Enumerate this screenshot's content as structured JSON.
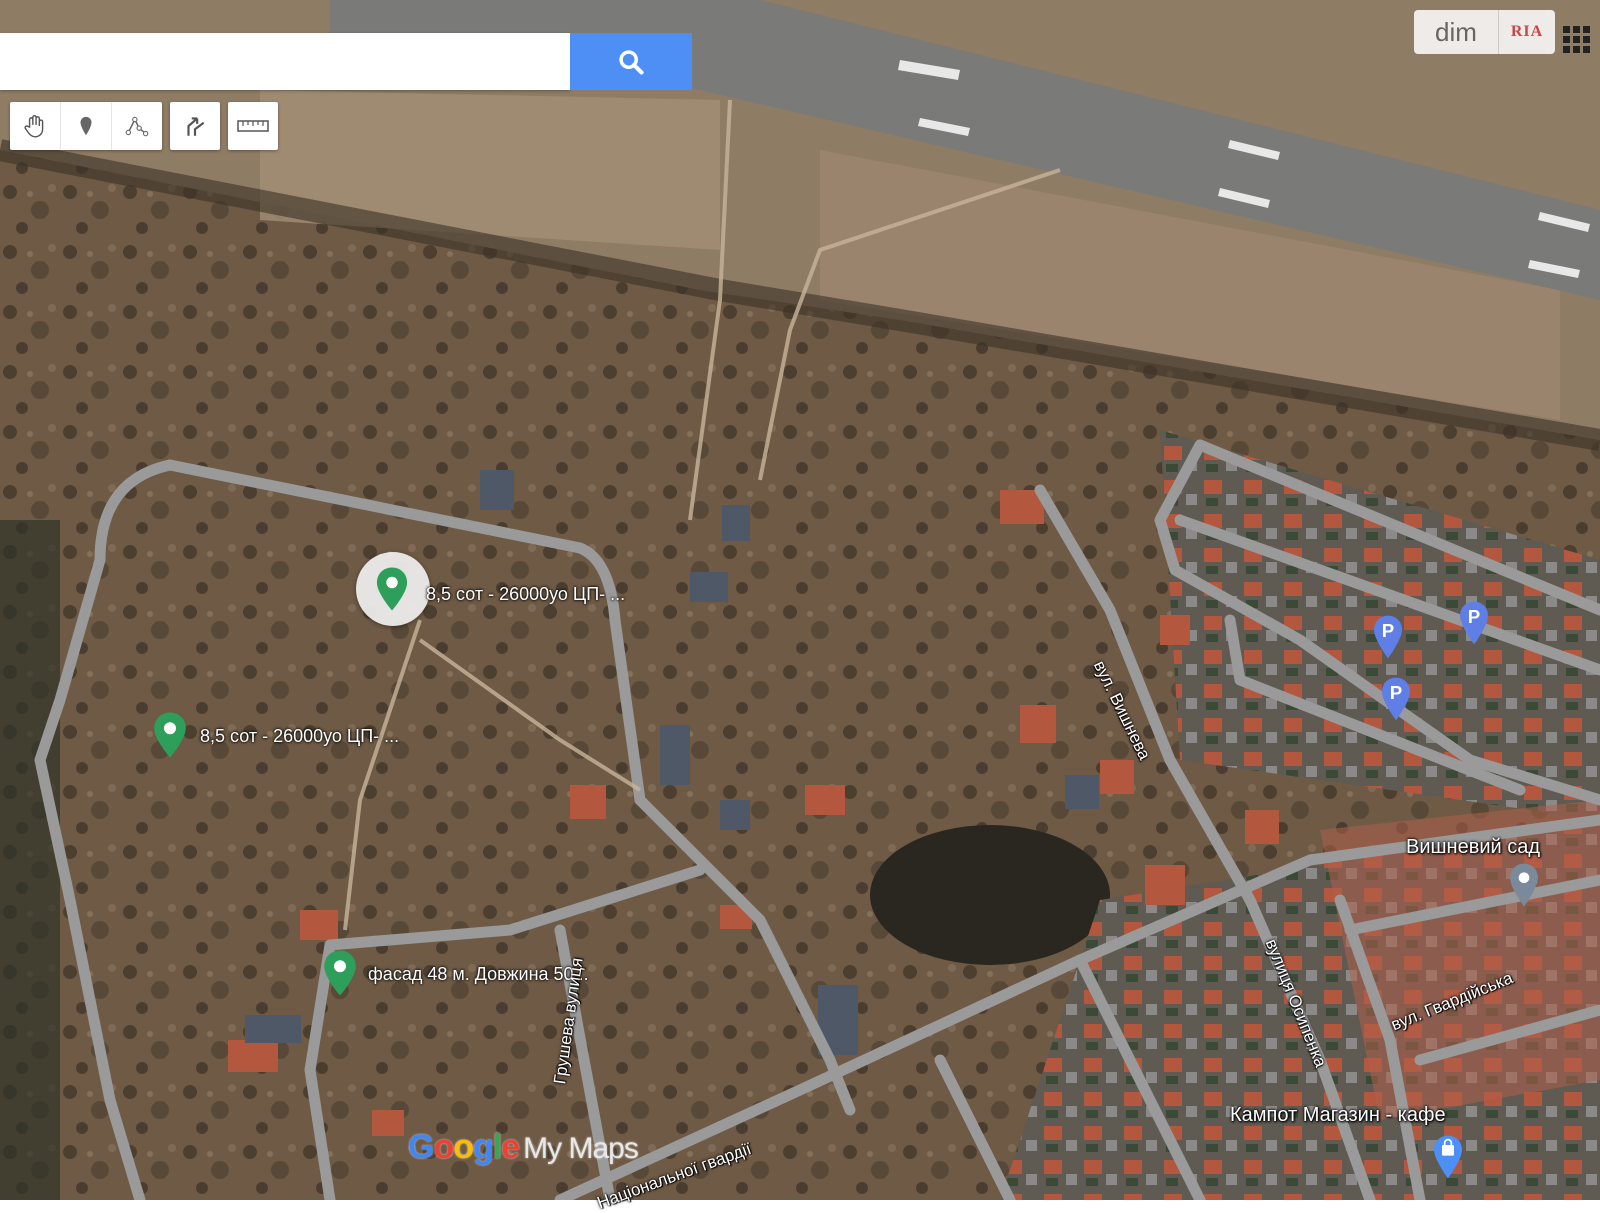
{
  "search": {
    "placeholder": "",
    "value": ""
  },
  "toolbar": {
    "tools": [
      "pan-hand",
      "add-marker",
      "draw-line",
      "directions",
      "measure"
    ]
  },
  "brand": {
    "dim": "dim",
    "ria": "RIA"
  },
  "markers": [
    {
      "label": "8,5 сот - 26000уо ЦП- ...",
      "color": "#2e9e5b",
      "selected": true
    },
    {
      "label": "8,5 сот - 26000уо ЦП- ...",
      "color": "#2e9e5b"
    },
    {
      "label": "фасад 48 м. Довжина 50...",
      "color": "#2e9e5b"
    }
  ],
  "places": {
    "vyshnevyi_sad": "Вишневий сад",
    "kampot": "Кампот Магазин - кафе"
  },
  "streets": {
    "vyshneva": "вул. Вишнева",
    "hrusheva": "Грушева вулиця",
    "osypenka": "вулиця Осипенка",
    "hvardiiska": "вул. Гвардійська",
    "natsgvardii": "Національної гвардії"
  },
  "parking_label": "P",
  "logo": {
    "google": "Google",
    "mymaps": "My Maps"
  },
  "colors": {
    "accent": "#4d8ff5",
    "marker": "#2e9e5b",
    "parking": "#5f7ee6"
  }
}
